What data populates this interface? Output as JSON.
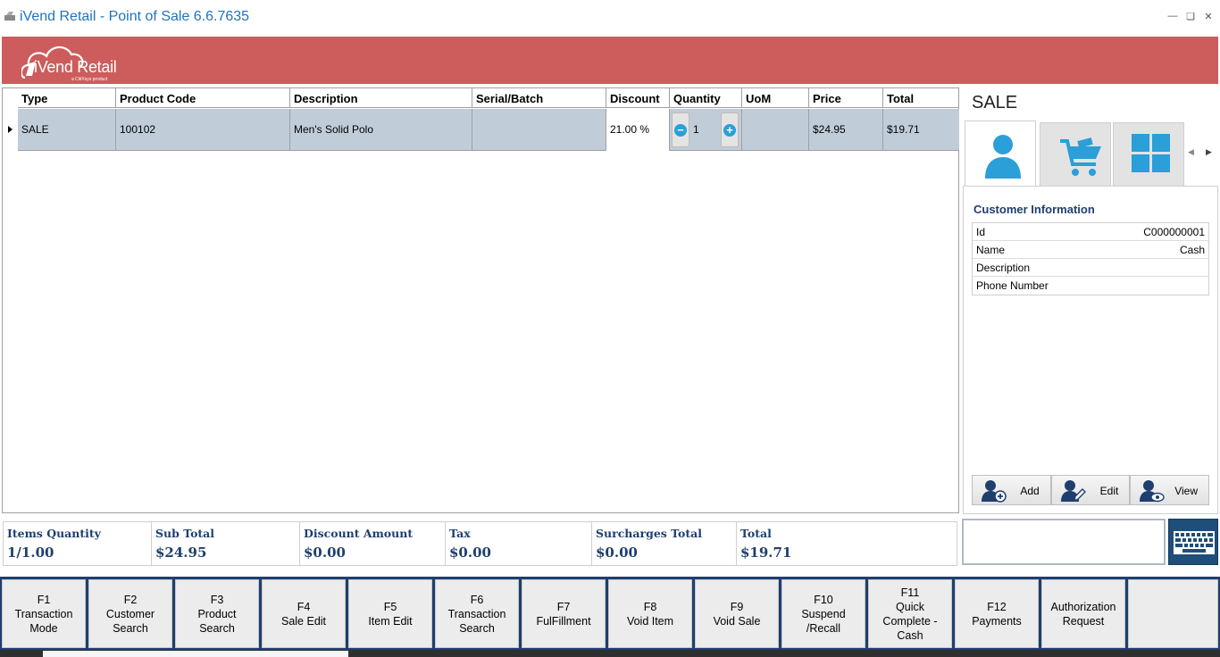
{
  "window": {
    "title": "iVend Retail - Point of Sale 6.6.7635",
    "controls": [
      "minimize",
      "restore",
      "close"
    ]
  },
  "brand": {
    "logo_text": "iVend Retail",
    "logo_sub": "a CitiXsys product",
    "banner_color": "#cd5c5c"
  },
  "grid": {
    "columns": [
      "Type",
      "Product Code",
      "Description",
      "Serial/Batch",
      "Discount",
      "Quantity",
      "UoM",
      "Price",
      "Total"
    ],
    "rows": [
      {
        "type": "SALE",
        "product_code": "100102",
        "description": "Men's Solid Polo",
        "serial_batch": "",
        "discount": "21.00 %",
        "quantity": "1",
        "uom": "",
        "price": "$24.95",
        "total": "$19.71"
      }
    ]
  },
  "panel": {
    "title": "SALE",
    "tabs": [
      {
        "icon": "customer-icon",
        "active": true
      },
      {
        "icon": "cart-icon",
        "active": false
      },
      {
        "icon": "tiles-icon",
        "active": false
      }
    ],
    "customer": {
      "heading": "Customer Information",
      "fields": [
        {
          "label": "Id",
          "value": "C000000001"
        },
        {
          "label": "Name",
          "value": "Cash"
        },
        {
          "label": "Description",
          "value": ""
        },
        {
          "label": "Phone Number",
          "value": ""
        }
      ]
    },
    "actions": [
      {
        "label": "Add",
        "icon": "add-user-icon"
      },
      {
        "label": "Edit",
        "icon": "edit-user-icon"
      },
      {
        "label": "View",
        "icon": "view-user-icon"
      }
    ]
  },
  "totals": [
    {
      "label": "Items Quantity",
      "value": "1/1.00"
    },
    {
      "label": "Sub Total",
      "value": "$24.95"
    },
    {
      "label": "Discount Amount",
      "value": "$0.00"
    },
    {
      "label": "Tax",
      "value": "$0.00"
    },
    {
      "label": "Surcharges Total",
      "value": "$0.00"
    },
    {
      "label": "Total",
      "value": "$19.71"
    }
  ],
  "scan": {
    "value": "",
    "placeholder": ""
  },
  "function_keys": [
    "F1\nTransaction\nMode",
    "F2\nCustomer\nSearch",
    "F3\nProduct\nSearch",
    "F4\nSale Edit",
    "F5\nItem Edit",
    "F6\nTransaction\nSearch",
    "F7\nFulFillment",
    "F8\nVoid Item",
    "F9\nVoid Sale",
    "F10\nSuspend\n/Recall",
    "F11\nQuick\nComplete -\nCash",
    "F12\nPayments",
    "Authorization\nRequest",
    ""
  ],
  "colors": {
    "title_text": "#1e73be",
    "accent_blue": "#2a9fd8",
    "dark_navy": "#1f3f6e",
    "row_selected": "#c0cdd9"
  }
}
